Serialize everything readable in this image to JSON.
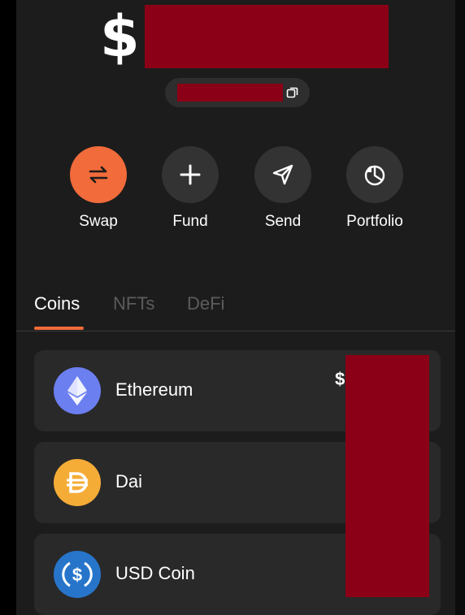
{
  "balance": {
    "currency_symbol": "$"
  },
  "actions": [
    {
      "label": "Swap",
      "icon": "swap-icon",
      "color": "#f26b3a"
    },
    {
      "label": "Fund",
      "icon": "plus-icon"
    },
    {
      "label": "Send",
      "icon": "send-icon"
    },
    {
      "label": "Portfolio",
      "icon": "pie-chart-icon"
    }
  ],
  "tabs": [
    {
      "label": "Coins",
      "active": true
    },
    {
      "label": "NFTs"
    },
    {
      "label": "DeFi"
    }
  ],
  "coins": [
    {
      "name": "Ethereum",
      "icon": "ethereum-icon",
      "color": "#6c7ff0"
    },
    {
      "name": "Dai",
      "icon": "dai-icon",
      "color": "#f5ac37"
    },
    {
      "name": "USD Coin",
      "icon": "usdc-icon",
      "color": "#2775ca"
    }
  ],
  "coin_value_prefix": "$",
  "colors": {
    "accent": "#f26b3a",
    "background": "#1c1c1c",
    "redacted": "#8b0016"
  }
}
